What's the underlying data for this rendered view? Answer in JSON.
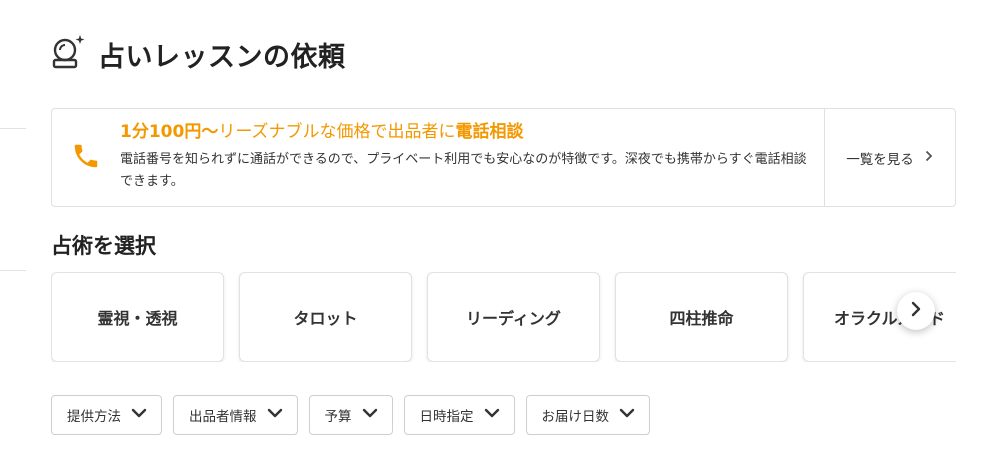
{
  "page": {
    "title": "占いレッスンの依頼",
    "icon": "fortune-ball-icon"
  },
  "banner": {
    "icon": "phone-icon",
    "headline_part1": "1分100円〜",
    "headline_part2": "リーズナブルな価格で出品者に",
    "headline_part3": "電話相談",
    "description": "電話番号を知られずに通話ができるので、プライベート利用でも安心なのが特徴です。深夜でも携帯からすぐ電話相談できます。",
    "link_label": "一覧を見る",
    "accent_color": "#f39800"
  },
  "categories": {
    "heading": "占術を選択",
    "items": [
      {
        "label": "霊視・透視"
      },
      {
        "label": "タロット"
      },
      {
        "label": "リーディング"
      },
      {
        "label": "四柱推命"
      },
      {
        "label": "オラクルカード"
      }
    ],
    "next_icon": "chevron-right-icon"
  },
  "filters": [
    {
      "label": "提供方法"
    },
    {
      "label": "出品者情報"
    },
    {
      "label": "予算"
    },
    {
      "label": "日時指定"
    },
    {
      "label": "お届け日数"
    }
  ]
}
